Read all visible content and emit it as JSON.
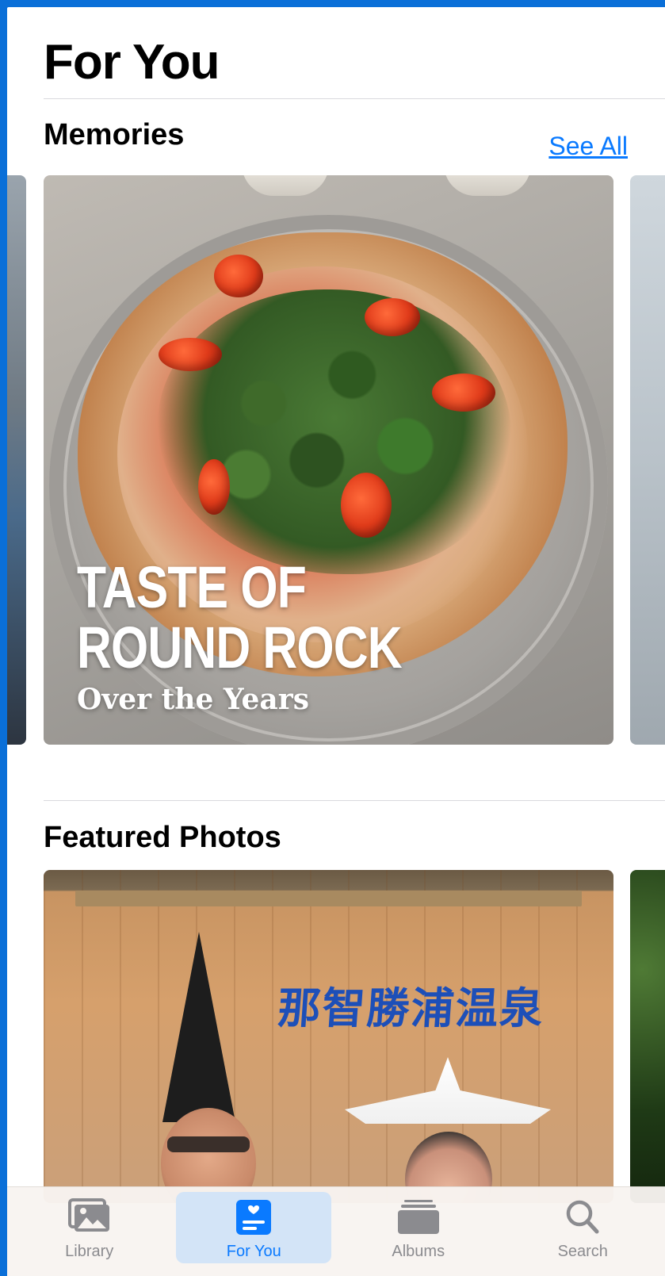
{
  "header": {
    "title": "For You"
  },
  "memories": {
    "section_title": "Memories",
    "see_all_label": "See All",
    "card": {
      "title": "TASTE OF\nROUND ROCK",
      "subtitle": "Over the Years"
    }
  },
  "featured": {
    "section_title": "Featured Photos",
    "photo_sign_text": "那智勝浦温泉"
  },
  "tabbar": {
    "items": [
      {
        "label": "Library",
        "icon": "library-icon",
        "active": false
      },
      {
        "label": "For You",
        "icon": "for-you-icon",
        "active": true
      },
      {
        "label": "Albums",
        "icon": "albums-icon",
        "active": false
      },
      {
        "label": "Search",
        "icon": "search-icon",
        "active": false
      }
    ]
  },
  "colors": {
    "accent": "#0a7aff",
    "frame": "#0a6fd8",
    "inactive_tab": "#8b8b8f"
  }
}
